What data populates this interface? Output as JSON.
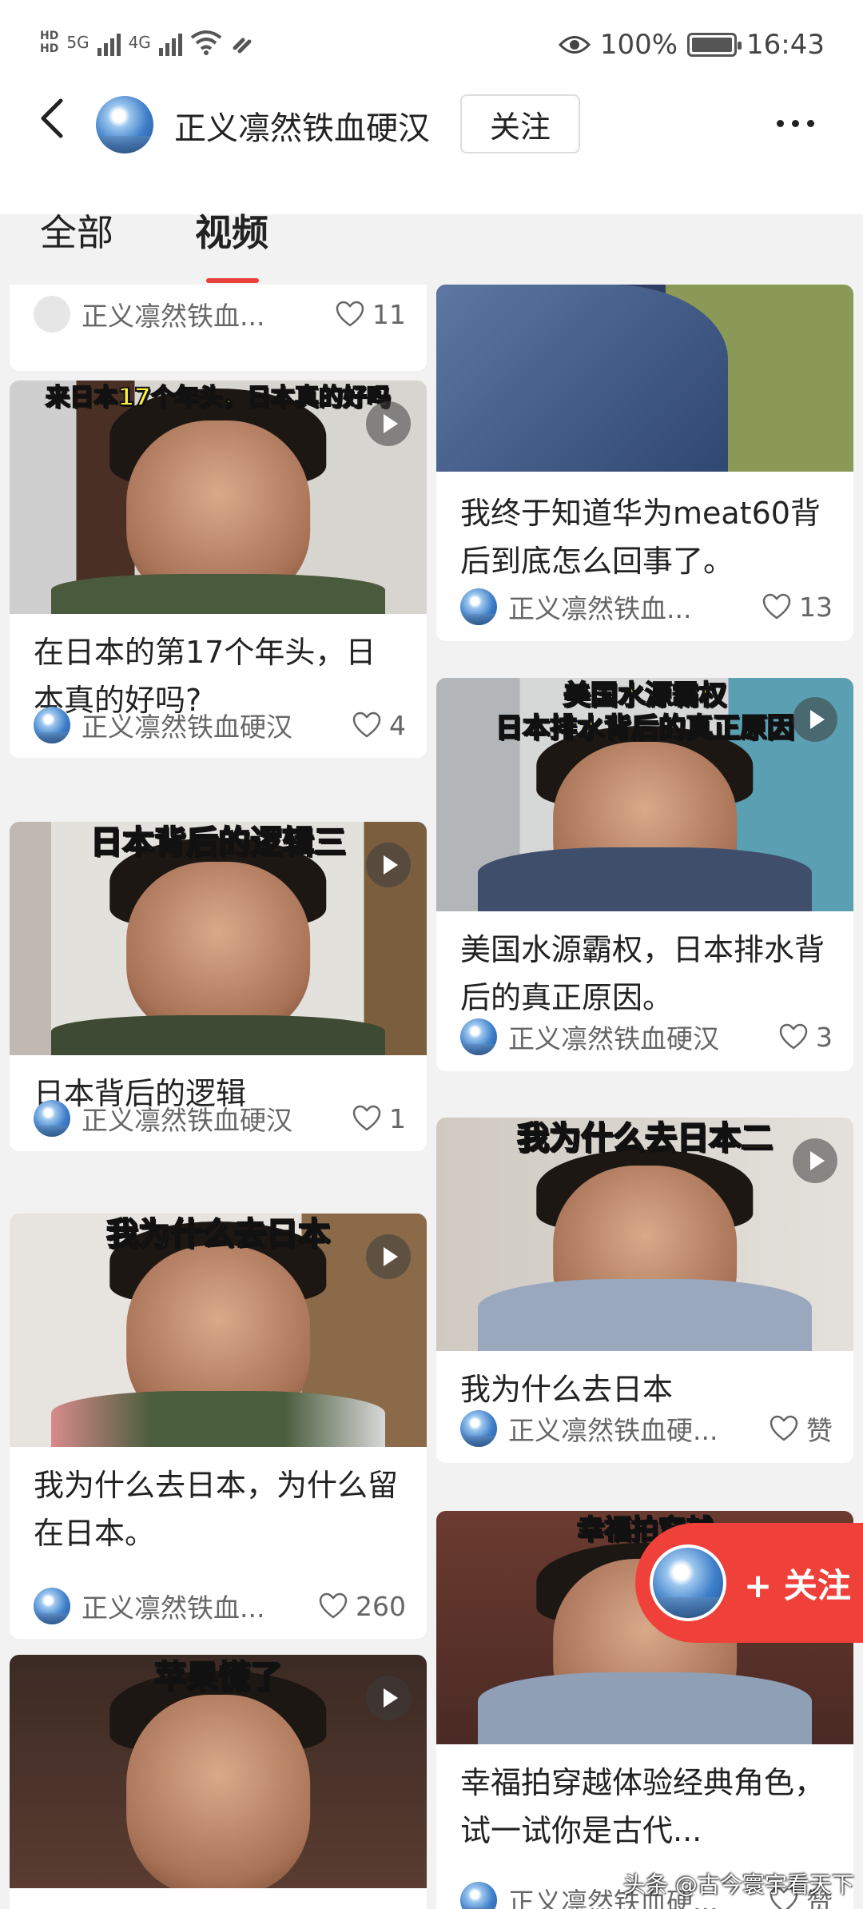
{
  "status_bar": {
    "network_1": "5G",
    "network_2": "4G",
    "battery": "100%",
    "time": "16:43"
  },
  "header": {
    "account_name": "正义凛然铁血硬汉",
    "follow_label": "关注"
  },
  "tabs": [
    {
      "label": "全部",
      "active": false
    },
    {
      "label": "视频",
      "active": true
    }
  ],
  "left_column": [
    {
      "title": "",
      "author": "正义凛然铁血...",
      "likes": "11",
      "thumb_text": ""
    },
    {
      "title": "在日本的第17个年头，日本真的好吗?",
      "author": "正义凛然铁血硬汉",
      "likes": "4",
      "thumb_text": "来日本17个年头，日本真的好吗"
    },
    {
      "title": "日本背后的逻辑",
      "author": "正义凛然铁血硬汉",
      "likes": "1",
      "thumb_text": "日本背后的逻辑三"
    },
    {
      "title": "我为什么去日本，为什么留在日本。",
      "author": "正义凛然铁血...",
      "likes": "260",
      "thumb_text": "我为什么去日本"
    },
    {
      "title": "",
      "author": "",
      "likes": "",
      "thumb_text": "苹果慌了"
    }
  ],
  "right_column": [
    {
      "title": "我终于知道华为meat60背后到底怎么回事了。",
      "author": "正义凛然铁血...",
      "likes": "13",
      "thumb_text": ""
    },
    {
      "title": "美国水源霸权，日本排水背后的真正原因。",
      "author": "正义凛然铁血硬汉",
      "likes": "3",
      "thumb_text": "美国水源霸权\n日本排水背后的真正原因"
    },
    {
      "title": "我为什么去日本",
      "author": "正义凛然铁血硬...",
      "likes": "赞",
      "thumb_text": "我为什么去日本二"
    },
    {
      "title": "幸福拍穿越体验经典角色，试一试你是古代...",
      "author": "正义凛然铁血硬...",
      "likes": "赞",
      "thumb_text": "幸福拍穿越"
    }
  ],
  "floating_follow": {
    "label": "+ 关注"
  },
  "watermark": "头条 @古今寰宇看天下",
  "colors": {
    "accent": "#e8403d",
    "overlay_text": "#fff23a"
  }
}
